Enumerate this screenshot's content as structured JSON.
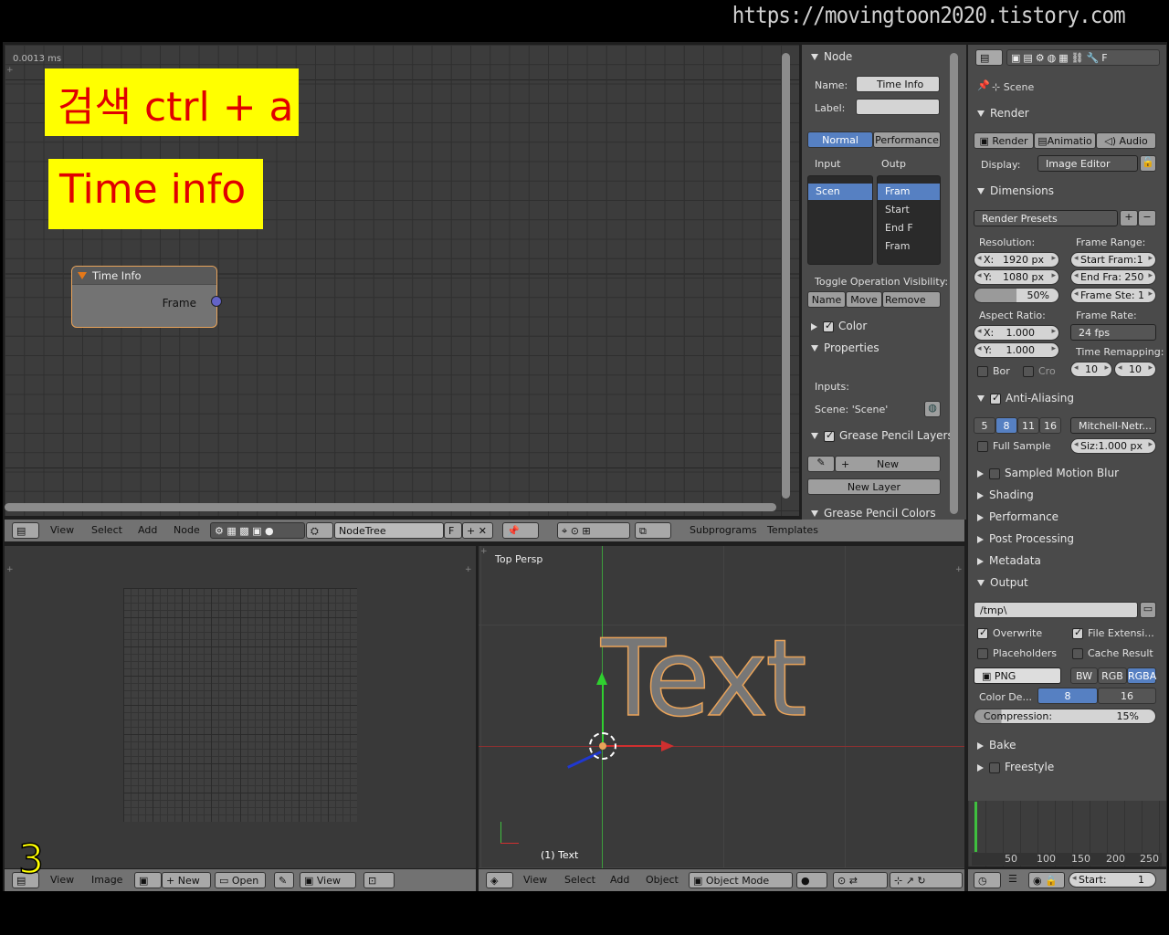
{
  "watermark": "https://movingtoon2020.tistory.com",
  "node_editor": {
    "timing": "0.0013 ms",
    "overlay1": "검색 ctrl + a",
    "overlay2": "Time info",
    "node": {
      "title": "Time Info",
      "output": "Frame"
    },
    "header": {
      "menus": [
        "View",
        "Select",
        "Add",
        "Node"
      ],
      "tree_name": "NodeTree",
      "fake_user": "F",
      "right": [
        "Subprograms",
        "Templates"
      ]
    }
  },
  "npanel": {
    "node_section": "Node",
    "name_label": "Name:",
    "name_value": "Time Info",
    "label_label": "Label:",
    "label_value": "",
    "mode_normal": "Normal",
    "mode_performance": "Performance",
    "input_label": "Input",
    "output_label": "Outp",
    "inputs": [
      "Scen"
    ],
    "outputs": [
      "Fram",
      "Start",
      "End F",
      "Fram"
    ],
    "toggle_label": "Toggle Operation Visibility:",
    "toggle_buttons": [
      "Name",
      "Move",
      "Remove"
    ],
    "color_section": "Color",
    "properties_section": "Properties",
    "inputs_label": "Inputs:",
    "scene_label": "Scene: 'Scene'",
    "grease_layers": "Grease Pencil Layers",
    "new_btn": "New",
    "new_layer": "New Layer",
    "grease_colors": "Grease Pencil Colors"
  },
  "image_editor": {
    "menus": [
      "View",
      "Image"
    ],
    "new": "New",
    "open": "Open",
    "view": "View",
    "overlay_number": "3"
  },
  "view3d": {
    "label": "Top Persp",
    "object": "(1) Text",
    "text_object": "Text",
    "menus": [
      "View",
      "Select",
      "Add",
      "Object"
    ],
    "mode": "Object Mode"
  },
  "properties": {
    "scene": "Scene",
    "render": {
      "title": "Render",
      "btn_render": "Render",
      "btn_anim": "Animatio",
      "btn_audio": "Audio",
      "display_label": "Display:",
      "display_value": "Image Editor"
    },
    "dimensions": {
      "title": "Dimensions",
      "presets": "Render Presets",
      "resolution": "Resolution:",
      "res_x": "1920 px",
      "res_y": "1080 px",
      "res_pct": "50%",
      "frame_range": "Frame Range:",
      "start": "Start Fram:1",
      "end": "End Fra: 250",
      "step": "Frame Ste: 1",
      "aspect": "Aspect Ratio:",
      "asp_x": "1.000",
      "asp_y": "1.000",
      "frame_rate": "Frame Rate:",
      "fps": "24 fps",
      "remap": "Time Remapping:",
      "remap_old": "10",
      "remap_new": "10",
      "border": "Bor",
      "crop": "Cro",
      "x": "X:",
      "y": "Y:"
    },
    "aa": {
      "title": "Anti-Aliasing",
      "samples": [
        "5",
        "8",
        "11",
        "16"
      ],
      "filter": "Mitchell-Netr...",
      "full_sample": "Full Sample",
      "size": "Siz:1.000 px"
    },
    "collapsed": [
      "Sampled Motion Blur",
      "Shading",
      "Performance",
      "Post Processing",
      "Metadata"
    ],
    "output": {
      "title": "Output",
      "path": "/tmp\\",
      "overwrite": "Overwrite",
      "file_ext": "File Extensi...",
      "placeholders": "Placeholders",
      "cache": "Cache Result",
      "format": "PNG",
      "bw": "BW",
      "rgb": "RGB",
      "rgba": "RGBA",
      "color_depth": "Color De...",
      "depth8": "8",
      "depth16": "16",
      "compression": "Compression:",
      "comp_value": "15%",
      "comp_fraction": 0.15
    },
    "bake": "Bake",
    "freestyle": "Freestyle"
  },
  "timeline": {
    "ticks": [
      "50",
      "100",
      "150",
      "200",
      "250"
    ],
    "start": "Start:",
    "start_value": "1"
  },
  "colors": {
    "accent": "#5680c2",
    "overlay_bg": "#ffff00",
    "overlay_fg": "#e00000",
    "node_outline": "#e8a35a"
  }
}
